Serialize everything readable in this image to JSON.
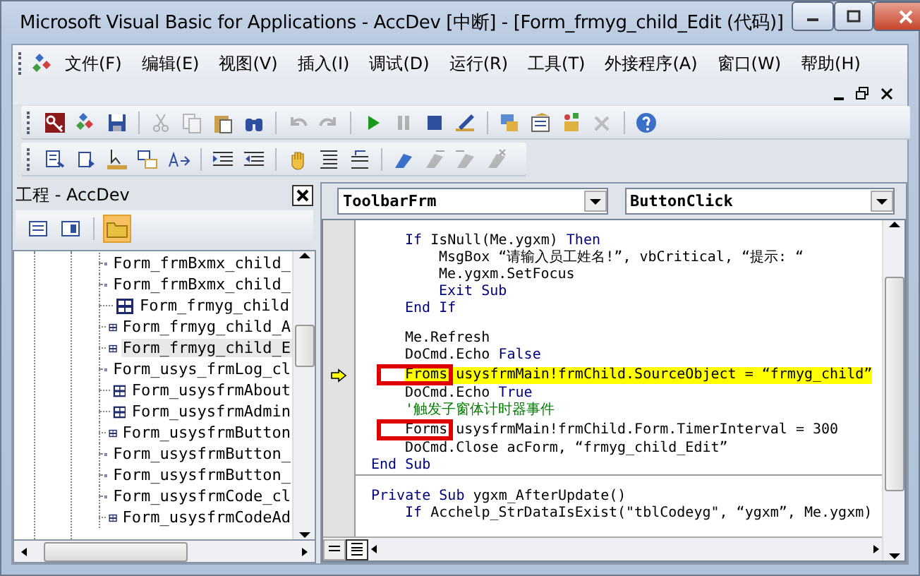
{
  "window": {
    "title": "Microsoft Visual Basic for Applications - AccDev [中断] - [Form_frmyg_child_Edit (代码)]"
  },
  "menu": [
    "文件(F)",
    "编辑(E)",
    "视图(V)",
    "插入(I)",
    "调试(D)",
    "运行(R)",
    "工具(T)",
    "外接程序(A)",
    "窗口(W)",
    "帮助(H)"
  ],
  "standard_toolbar": [
    {
      "disabled": false
    },
    {
      "disabled": false
    },
    {
      "disabled": false
    },
    {
      "disabled": true
    },
    {
      "disabled": true
    },
    {
      "disabled": false
    },
    {
      "disabled": false
    },
    {
      "disabled": true
    },
    {
      "disabled": true
    },
    {
      "disabled": false
    },
    {
      "disabled": true
    },
    {
      "disabled": false
    },
    {
      "disabled": false
    },
    {
      "disabled": false
    },
    {
      "disabled": false
    },
    {
      "disabled": false
    },
    {
      "disabled": true
    },
    {
      "disabled": false
    }
  ],
  "edit_toolbar": [
    {
      "disabled": false
    },
    {
      "disabled": false
    },
    {
      "disabled": false
    },
    {
      "disabled": false
    },
    {
      "disabled": false
    },
    {
      "disabled": false
    },
    {
      "disabled": false
    },
    {
      "disabled": false
    },
    {
      "disabled": false
    },
    {
      "disabled": false
    },
    {
      "disabled": false
    },
    {
      "disabled": true
    },
    {
      "disabled": true
    },
    {
      "disabled": true
    }
  ],
  "project_panel": {
    "title": "工程 - AccDev",
    "items": [
      {
        "label": "Form_frmBxmx_child_",
        "selected": false
      },
      {
        "label": "Form_frmBxmx_child_",
        "selected": false
      },
      {
        "label": "Form_frmyg_child",
        "selected": false
      },
      {
        "label": "Form_frmyg_child_A",
        "selected": false
      },
      {
        "label": "Form_frmyg_child_E",
        "selected": true
      },
      {
        "label": "Form_usys_frmLog_cl",
        "selected": false
      },
      {
        "label": "Form_usysfrmAbout",
        "selected": false
      },
      {
        "label": "Form_usysfrmAdmin",
        "selected": false
      },
      {
        "label": "Form_usysfrmButton",
        "selected": false
      },
      {
        "label": "Form_usysfrmButton_",
        "selected": false
      },
      {
        "label": "Form_usysfrmButton_",
        "selected": false
      },
      {
        "label": "Form_usysfrmCode_cl",
        "selected": false
      },
      {
        "label": "Form_usysfrmCodeAd",
        "selected": false
      }
    ]
  },
  "code_window": {
    "object_dropdown": "ToolbarFrm",
    "procedure_dropdown": "ButtonClick",
    "procedures": [
      {
        "lines": [
          {
            "kind": "blank"
          },
          {
            "children": [
              {
                "tokens": [
                  {
                    "text": "If",
                    "kind": "keyword"
                  },
                  {
                    "text": " IsNull(Me.ygxm) ",
                    "kind": "plain"
                  },
                  {
                    "text": "Then",
                    "kind": "keyword"
                  }
                ],
                "children": [
                  {
                    "tokens": [
                      {
                        "text": "MsgBox “请输入员工姓名!”, vbCritical, “提示: “",
                        "kind": "plain"
                      }
                    ]
                  },
                  {
                    "tokens": [
                      {
                        "text": "Me.ygxm.SetFocus",
                        "kind": "plain"
                      }
                    ]
                  },
                  {
                    "tokens": [
                      {
                        "text": "Exit Sub",
                        "kind": "keyword"
                      }
                    ]
                  }
                ]
              },
              {
                "tokens": [
                  {
                    "text": "End If",
                    "kind": "keyword"
                  }
                ]
              },
              {
                "kind": "blank"
              },
              {
                "tokens": [
                  {
                    "text": "Me.Refresh",
                    "kind": "plain"
                  }
                ]
              },
              {
                "tokens": [
                  {
                    "text": "DoCmd.Echo ",
                    "kind": "plain"
                  },
                  {
                    "text": "False",
                    "kind": "keyword"
                  }
                ]
              },
              {
                "tokens": [
                  {
                    "text": "Froms",
                    "kind": "plain"
                  },
                  {
                    "text": " usysfrmMain!frmChild.SourceObject = “frmyg_child”",
                    "kind": "plain"
                  }
                ],
                "current": true,
                "boxed": true
              },
              {
                "tokens": [
                  {
                    "text": "DoCmd.Echo ",
                    "kind": "plain"
                  },
                  {
                    "text": "True",
                    "kind": "keyword"
                  }
                ]
              },
              {
                "tokens": [
                  {
                    "text": "'触发子窗体计时器事件",
                    "kind": "comment"
                  }
                ]
              },
              {
                "tokens": [
                  {
                    "text": "Forms",
                    "kind": "plain"
                  },
                  {
                    "text": " usysfrmMain!frmChild.Form.TimerInterval = 300",
                    "kind": "plain"
                  }
                ],
                "boxed": true
              },
              {
                "tokens": [
                  {
                    "text": "DoCmd.Close acForm, “frmyg_child_Edit”",
                    "kind": "plain"
                  }
                ]
              }
            ]
          },
          {
            "tokens": [
              {
                "text": "End Sub",
                "kind": "keyword"
              }
            ]
          }
        ]
      },
      {
        "lines": [
          {
            "kind": "blank"
          },
          {
            "tokens": [
              {
                "text": "Private Sub",
                "kind": "keyword"
              },
              {
                "text": " ygxm_AfterUpdate()",
                "kind": "plain"
              }
            ],
            "children": [
              {
                "tokens": [
                  {
                    "text": "If",
                    "kind": "keyword"
                  },
                  {
                    "text": " Acchelp_StrDataIsExist(\"tblCodeyg\", “ygxm”, Me.ygxm)",
                    "kind": "plain"
                  }
                ]
              }
            ]
          }
        ]
      }
    ]
  }
}
